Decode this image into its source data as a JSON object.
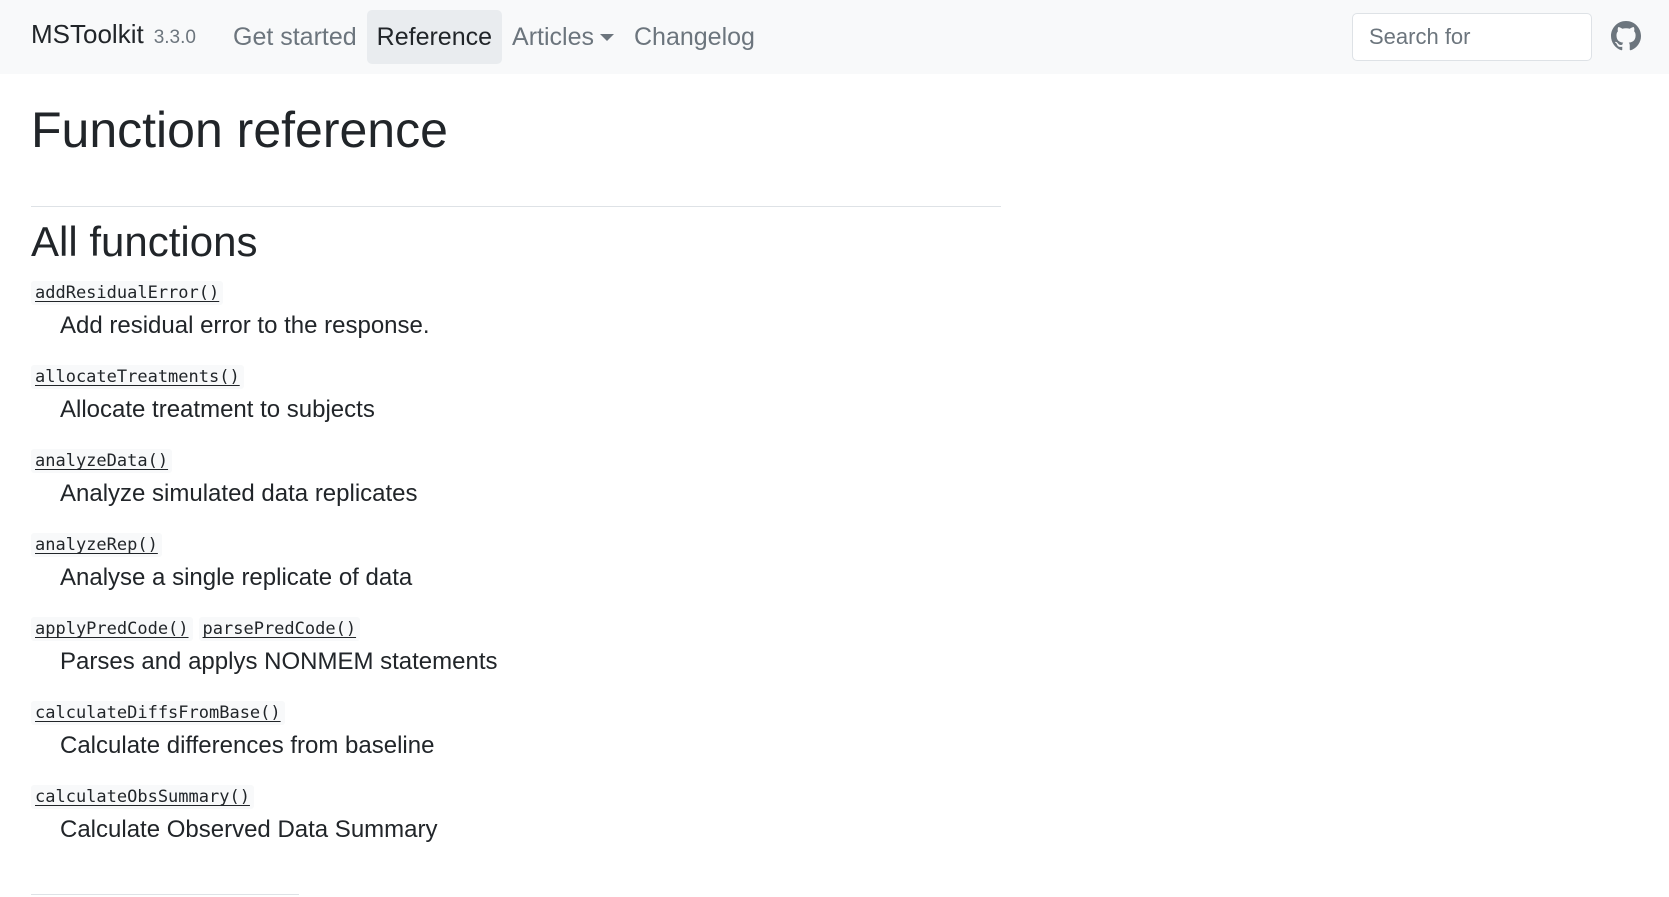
{
  "navbar": {
    "brand": "MSToolkit",
    "version": "3.3.0",
    "links": [
      {
        "label": "Get started"
      },
      {
        "label": "Reference"
      },
      {
        "label": "Articles"
      },
      {
        "label": "Changelog"
      }
    ],
    "search_placeholder": "Search for",
    "github_icon": "github-icon"
  },
  "page": {
    "title": "Function reference",
    "section_title": "All functions"
  },
  "functions": [
    {
      "names": [
        "addResidualError()"
      ],
      "description": "Add residual error to the response."
    },
    {
      "names": [
        "allocateTreatments()"
      ],
      "description": "Allocate treatment to subjects"
    },
    {
      "names": [
        "analyzeData()"
      ],
      "description": "Analyze simulated data replicates"
    },
    {
      "names": [
        "analyzeRep()"
      ],
      "description": "Analyse a single replicate of data"
    },
    {
      "names": [
        "applyPredCode()",
        "parsePredCode()"
      ],
      "description": "Parses and applys NONMEM statements"
    },
    {
      "names": [
        "calculateDiffsFromBase()"
      ],
      "description": "Calculate differences from baseline"
    },
    {
      "names": [
        "calculateObsSummary()"
      ],
      "description": "Calculate Observed Data Summary"
    }
  ]
}
